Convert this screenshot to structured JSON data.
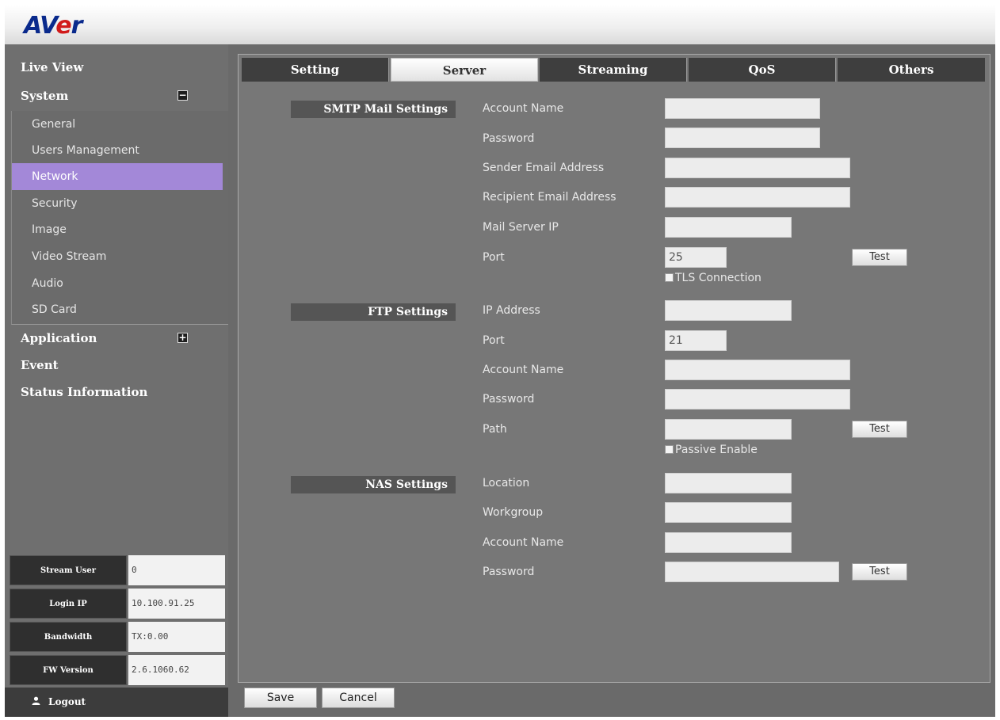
{
  "header": {
    "logo_part1": "AV",
    "logo_part2": "e",
    "logo_part3": "r"
  },
  "sidebar": {
    "live_view": "Live View",
    "system": "System",
    "system_toggle": "−",
    "system_items": [
      "General",
      "Users Management",
      "Network",
      "Security",
      "Image",
      "Video Stream",
      "Audio",
      "SD Card"
    ],
    "active_item": "Network",
    "application": "Application",
    "application_toggle": "+",
    "event": "Event",
    "status_information": "Status Information"
  },
  "status_info": {
    "stream_user_label": "Stream User",
    "stream_user_value": "0",
    "login_ip_label": "Login IP",
    "login_ip_value": "10.100.91.25",
    "bandwidth_label": "Bandwidth",
    "bandwidth_value": "TX:0.00",
    "fw_version_label": "FW Version",
    "fw_version_value": "2.6.1060.62"
  },
  "logout": {
    "label": "Logout",
    "icon": "user-icon"
  },
  "tabs": [
    "Setting",
    "Server",
    "Streaming",
    "QoS",
    "Others"
  ],
  "active_tab": "Server",
  "smtp": {
    "section_label": "SMTP Mail Settings",
    "account_name_label": "Account Name",
    "account_name_value": "",
    "password_label": "Password",
    "password_value": "",
    "sender_label": "Sender Email Address",
    "sender_value": "",
    "recipient_label": "Recipient Email Address",
    "recipient_value": "",
    "server_ip_label": "Mail Server IP",
    "server_ip_value": "",
    "port_label": "Port",
    "port_value": "25",
    "test_label": "Test",
    "tls_label": "TLS Connection"
  },
  "ftp": {
    "section_label": "FTP Settings",
    "ip_label": "IP Address",
    "ip_value": "",
    "port_label": "Port",
    "port_value": "21",
    "account_name_label": "Account Name",
    "account_name_value": "",
    "password_label": "Password",
    "password_value": "",
    "path_label": "Path",
    "path_value": "",
    "test_label": "Test",
    "passive_label": "Passive Enable"
  },
  "nas": {
    "section_label": "NAS Settings",
    "location_label": "Location",
    "location_value": "",
    "workgroup_label": "Workgroup",
    "workgroup_value": "",
    "account_name_label": "Account Name",
    "account_name_value": "",
    "password_label": "Password",
    "password_value": "",
    "test_label": "Test"
  },
  "footer": {
    "save_label": "Save",
    "cancel_label": "Cancel"
  }
}
